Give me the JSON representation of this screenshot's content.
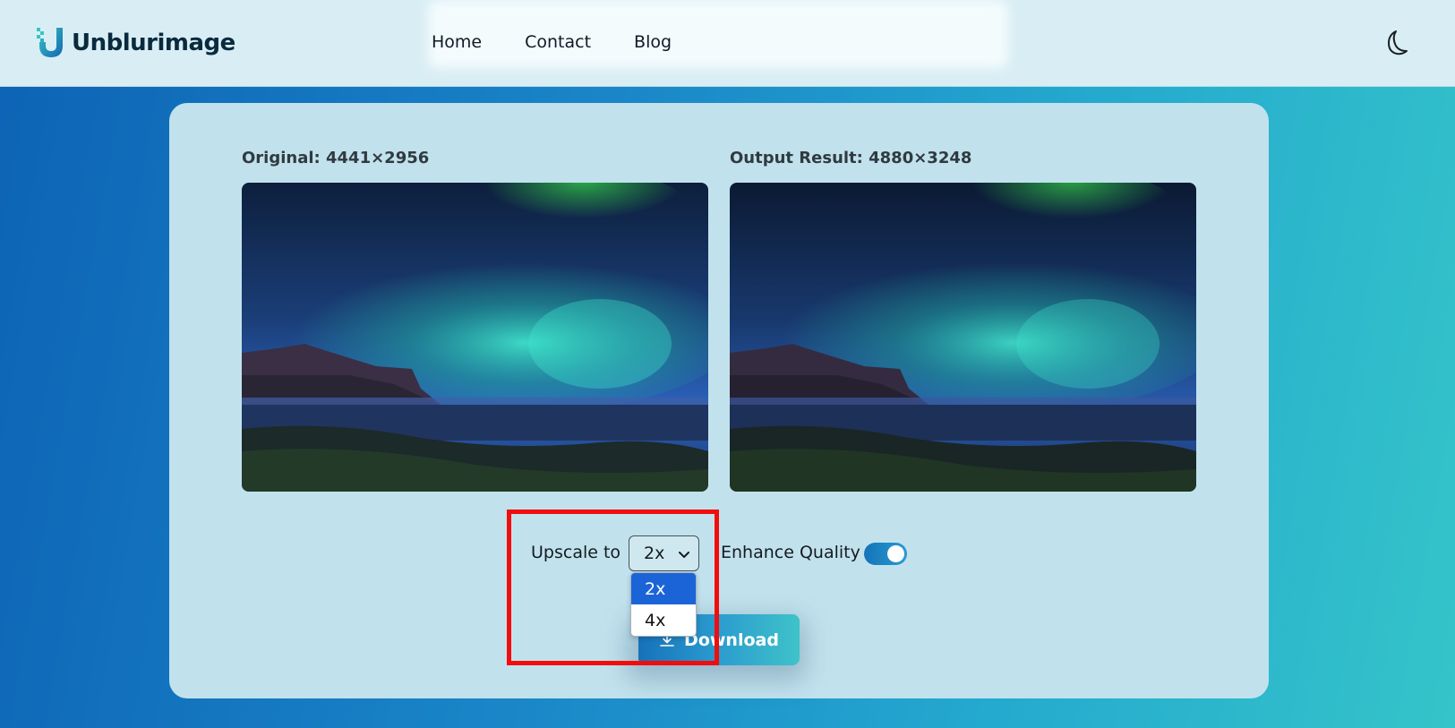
{
  "app": {
    "brand": "Unblurimage"
  },
  "nav": {
    "links": [
      "Home",
      "Contact",
      "Blog"
    ]
  },
  "icons": {
    "theme_toggle": "moon-icon",
    "select_chevron": "chevron-down-icon",
    "download": "download-icon"
  },
  "images": {
    "original_label": "Original: 4441×2956",
    "output_label": "Output Result: 4880×3248"
  },
  "controls": {
    "upscale_label": "Upscale to",
    "upscale_value": "2x",
    "upscale_options": [
      "2x",
      "4x"
    ],
    "selected_option": "2x",
    "enhance_label": "Enhance Quality",
    "enhance_enabled": true,
    "download_label": "Download"
  },
  "colors": {
    "accent": "#1672ba",
    "highlight": "#f20c0c",
    "selected_option": "#1b64d8"
  }
}
